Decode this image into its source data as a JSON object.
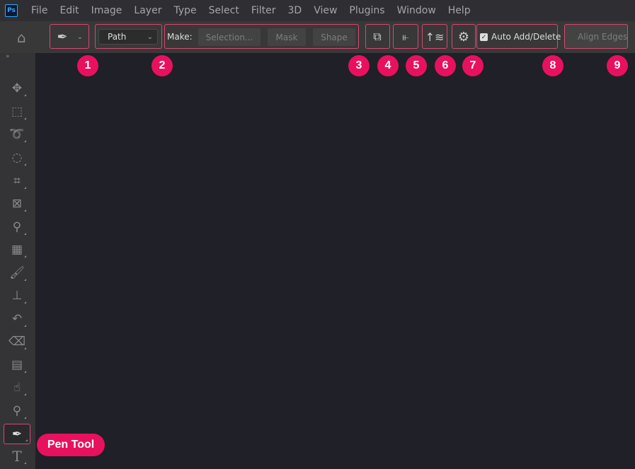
{
  "app": {
    "logo": "Ps"
  },
  "menu": [
    "File",
    "Edit",
    "Image",
    "Layer",
    "Type",
    "Select",
    "Filter",
    "3D",
    "View",
    "Plugins",
    "Window",
    "Help"
  ],
  "options": {
    "home_icon": "home-icon",
    "tool_preset_icon": "pen-icon",
    "mode_value": "Path",
    "make_label": "Make:",
    "selection_label": "Selection...",
    "mask_label": "Mask",
    "shape_label": "Shape",
    "auto_add_delete_label": "Auto Add/Delete",
    "auto_add_delete_checked": true,
    "align_edges_label": "Align Edges"
  },
  "annotations": {
    "numbers": [
      "1",
      "2",
      "3",
      "4",
      "5",
      "6",
      "7",
      "8",
      "9"
    ],
    "pen_tool_label": "Pen Tool",
    "color": "#e8115e"
  },
  "tools": [
    "move",
    "rectangular-marquee",
    "lasso",
    "quick-selection",
    "crop",
    "frame",
    "eyedropper",
    "spot-healing",
    "brush",
    "clone-stamp",
    "history-brush",
    "eraser",
    "gradient",
    "blur",
    "dodge",
    "pen",
    "type"
  ],
  "active_tool": "pen"
}
